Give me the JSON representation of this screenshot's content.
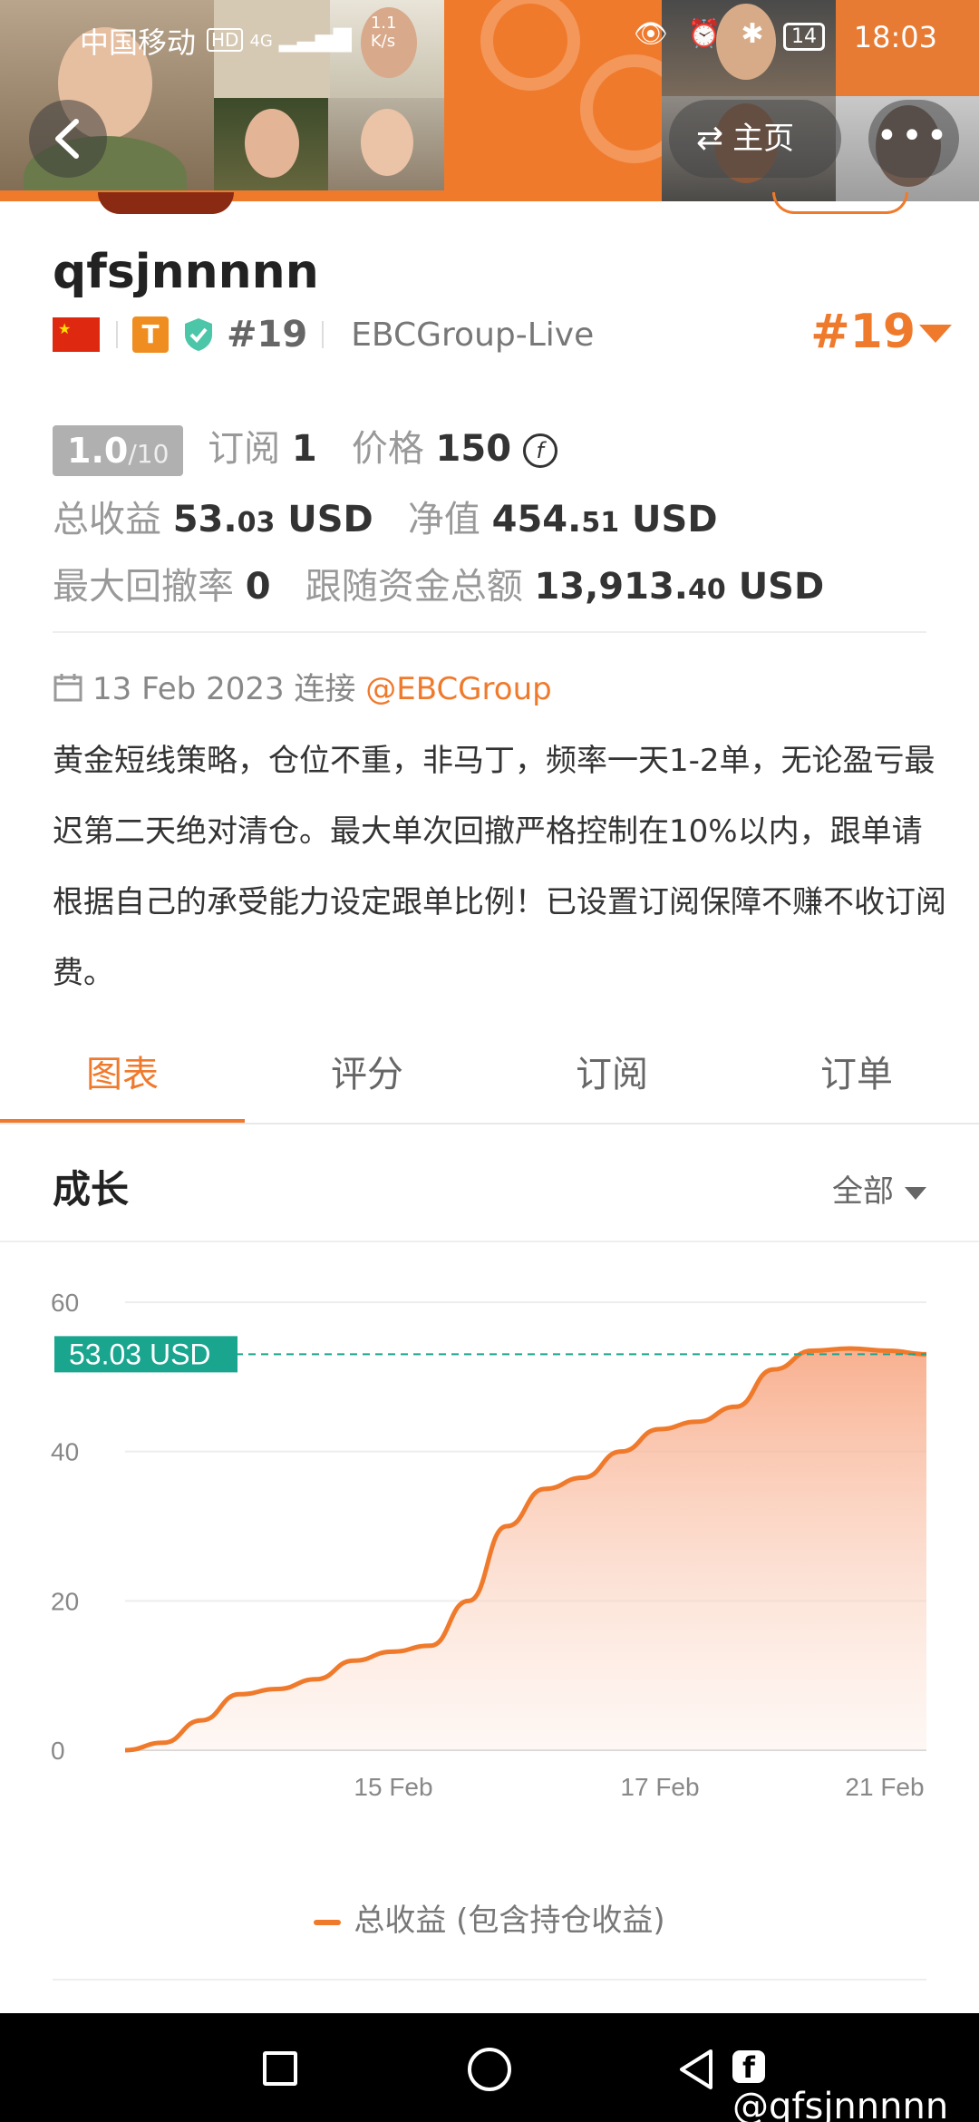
{
  "status_bar": {
    "carrier": "中国移动",
    "network": "4G",
    "speed": "1.1 K/s",
    "time": "18:03",
    "battery": "14"
  },
  "header": {
    "home_label": "主页",
    "more_label": "•••"
  },
  "profile": {
    "username": "qfsjnnnnn",
    "rank_small": "#19",
    "group": "EBCGroup-Live",
    "rank_big": "#19",
    "t_badge": "T"
  },
  "stats": {
    "score": "1.0",
    "score_max": "/10",
    "subscribe_label": "订阅",
    "subscribe_value": "1",
    "price_label": "价格",
    "price_value": "150",
    "coin_symbol": "f",
    "total_profit_label": "总收益",
    "total_profit_int": "53.",
    "total_profit_dec": "03",
    "total_profit_unit": "USD",
    "net_value_label": "净值",
    "net_value_int": "454.",
    "net_value_dec": "51",
    "net_value_unit": "USD",
    "max_drawdown_label": "最大回撤率",
    "max_drawdown_value": "0",
    "follow_funds_label": "跟随资金总额",
    "follow_funds_int": "13,913.",
    "follow_funds_dec": "40",
    "follow_funds_unit": "USD"
  },
  "connection": {
    "date": "13 Feb 2023",
    "connect_label": "连接",
    "broker": "@EBCGroup"
  },
  "description": "黄金短线策略，仓位不重，非马丁，频率一天1-2单，无论盈亏最迟第二天绝对清仓。最大单次回撤严格控制在10%以内，跟单请根据自己的承受能力设定跟单比例！已设置订阅保障不赚不收订阅费。",
  "tabs": [
    {
      "label": "图表",
      "active": true
    },
    {
      "label": "评分",
      "active": false
    },
    {
      "label": "订阅",
      "active": false
    },
    {
      "label": "订单",
      "active": false
    }
  ],
  "growth": {
    "title": "成长",
    "range": "全部"
  },
  "chart_data": {
    "type": "area",
    "title": "",
    "xlabel": "",
    "ylabel": "",
    "ylim": [
      0,
      60
    ],
    "yticks": [
      0,
      20,
      40,
      60
    ],
    "xticks": [
      "15 Feb",
      "17 Feb",
      "21 Feb"
    ],
    "current_value_label": "53.03 USD",
    "current_value": 53.03,
    "series": [
      {
        "name": "总收益 (包含持仓收益)",
        "values": [
          0,
          1,
          4,
          7.5,
          8.2,
          9.5,
          12,
          13.2,
          14,
          20,
          30,
          35,
          36.5,
          40,
          43,
          44,
          46,
          51,
          53.5,
          53.8,
          53.5,
          53.03
        ]
      }
    ],
    "grid": true,
    "colors": {
      "line": "#f07a2c",
      "marker": "#1aa58f"
    }
  },
  "legend": {
    "label": "总收益 (包含持仓收益)"
  },
  "nav": {
    "watermark": "@qfsjnnnnn"
  }
}
